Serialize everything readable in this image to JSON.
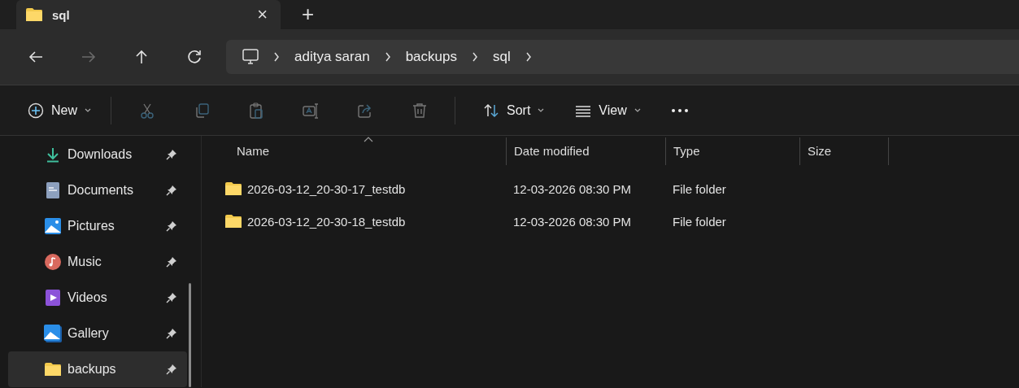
{
  "tab_bar": {
    "tabs": [
      {
        "title": "sql",
        "selected": true,
        "close": "×"
      }
    ],
    "new_tab": "+"
  },
  "navigation": {
    "buttons": [
      {
        "kind": "back",
        "disabled": false
      },
      {
        "kind": "forward",
        "disabled": true
      },
      {
        "kind": "up",
        "disabled": false
      },
      {
        "kind": "refresh",
        "disabled": false
      }
    ],
    "address_bar": {
      "crumbs": [
        "aditya saran",
        "backups",
        "sql"
      ]
    }
  },
  "toolbar": {
    "items": [
      {
        "kind": "new",
        "label": "New",
        "disabled": false
      },
      {
        "kind": "cut",
        "disabled": true
      },
      {
        "kind": "copy",
        "disabled": true
      },
      {
        "kind": "paste",
        "disabled": true
      },
      {
        "kind": "rename",
        "disabled": true
      },
      {
        "kind": "share",
        "disabled": true
      },
      {
        "kind": "delete",
        "disabled": true
      },
      {
        "kind": "sort",
        "label": "Sort",
        "disabled": false
      },
      {
        "kind": "view",
        "label": "View",
        "disabled": false
      },
      {
        "kind": "more",
        "disabled": false
      }
    ]
  },
  "sidebar": {
    "items": [
      {
        "label": "Downloads",
        "kind": "downloads",
        "pinned": true,
        "selected": false
      },
      {
        "label": "Documents",
        "kind": "documents",
        "pinned": true,
        "selected": false
      },
      {
        "label": "Pictures",
        "kind": "pictures",
        "pinned": true,
        "selected": false
      },
      {
        "label": "Music",
        "kind": "music",
        "pinned": true,
        "selected": false
      },
      {
        "label": "Videos",
        "kind": "videos",
        "pinned": true,
        "selected": false
      },
      {
        "label": "Gallery",
        "kind": "gallery",
        "pinned": true,
        "selected": false
      },
      {
        "label": "backups",
        "kind": "folder",
        "pinned": true,
        "selected": true
      }
    ]
  },
  "table": {
    "columns": [
      {
        "label": "Name",
        "sorted": true
      },
      {
        "label": "Date modified",
        "sorted": false
      },
      {
        "label": "Type",
        "sorted": false
      },
      {
        "label": "Size",
        "sorted": false
      }
    ],
    "rows": [
      {
        "kind": "folder",
        "name": "2026-03-12_20-30-17_testdb",
        "date": "12-03-2026 08:30 PM",
        "type": "File folder",
        "selected": false
      },
      {
        "kind": "folder",
        "name": "2026-03-12_20-30-18_testdb",
        "date": "12-03-2026 08:30 PM",
        "type": "File folder",
        "selected": false
      }
    ]
  }
}
